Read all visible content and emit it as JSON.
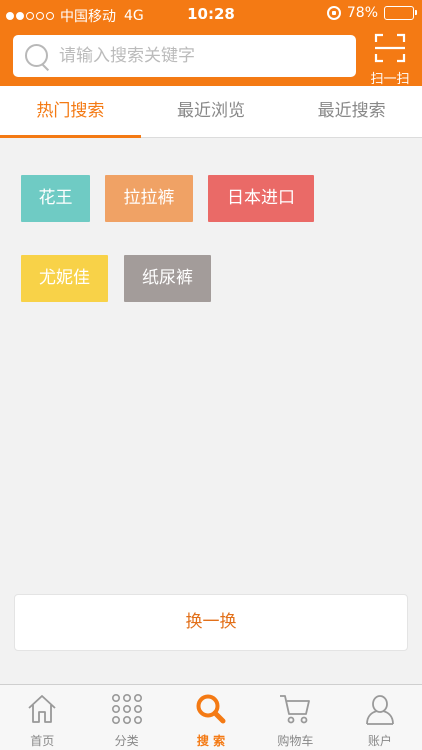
{
  "status_bar": {
    "carrier": "中国移动",
    "network": "4G",
    "time": "10:28",
    "battery": "78%",
    "battery_level": 0.78,
    "signal_bars": 2
  },
  "search": {
    "placeholder": "请输入搜索关键字"
  },
  "scan": {
    "label": "扫一扫"
  },
  "tabs": [
    {
      "label": "热门搜索",
      "active": true
    },
    {
      "label": "最近浏览",
      "active": false
    },
    {
      "label": "最近搜索",
      "active": false
    }
  ],
  "hot_tags": [
    {
      "label": "花王",
      "color": "#6fcbc4"
    },
    {
      "label": "拉拉裤",
      "color": "#f0a265"
    },
    {
      "label": "日本进口",
      "color": "#ea6a67"
    },
    {
      "label": "尤妮佳",
      "color": "#f8d248"
    },
    {
      "label": "纸尿裤",
      "color": "#a39c9a"
    }
  ],
  "refresh": {
    "label": "换一换"
  },
  "tabbar": [
    {
      "label": "首页",
      "icon": "home-icon"
    },
    {
      "label": "分类",
      "icon": "grid-icon"
    },
    {
      "label": "搜 索",
      "icon": "search-icon",
      "active": true
    },
    {
      "label": "购物车",
      "icon": "cart-icon"
    },
    {
      "label": "账户",
      "icon": "user-icon"
    }
  ],
  "colors": {
    "accent": "#f47a14",
    "background": "#f2f2f2"
  }
}
